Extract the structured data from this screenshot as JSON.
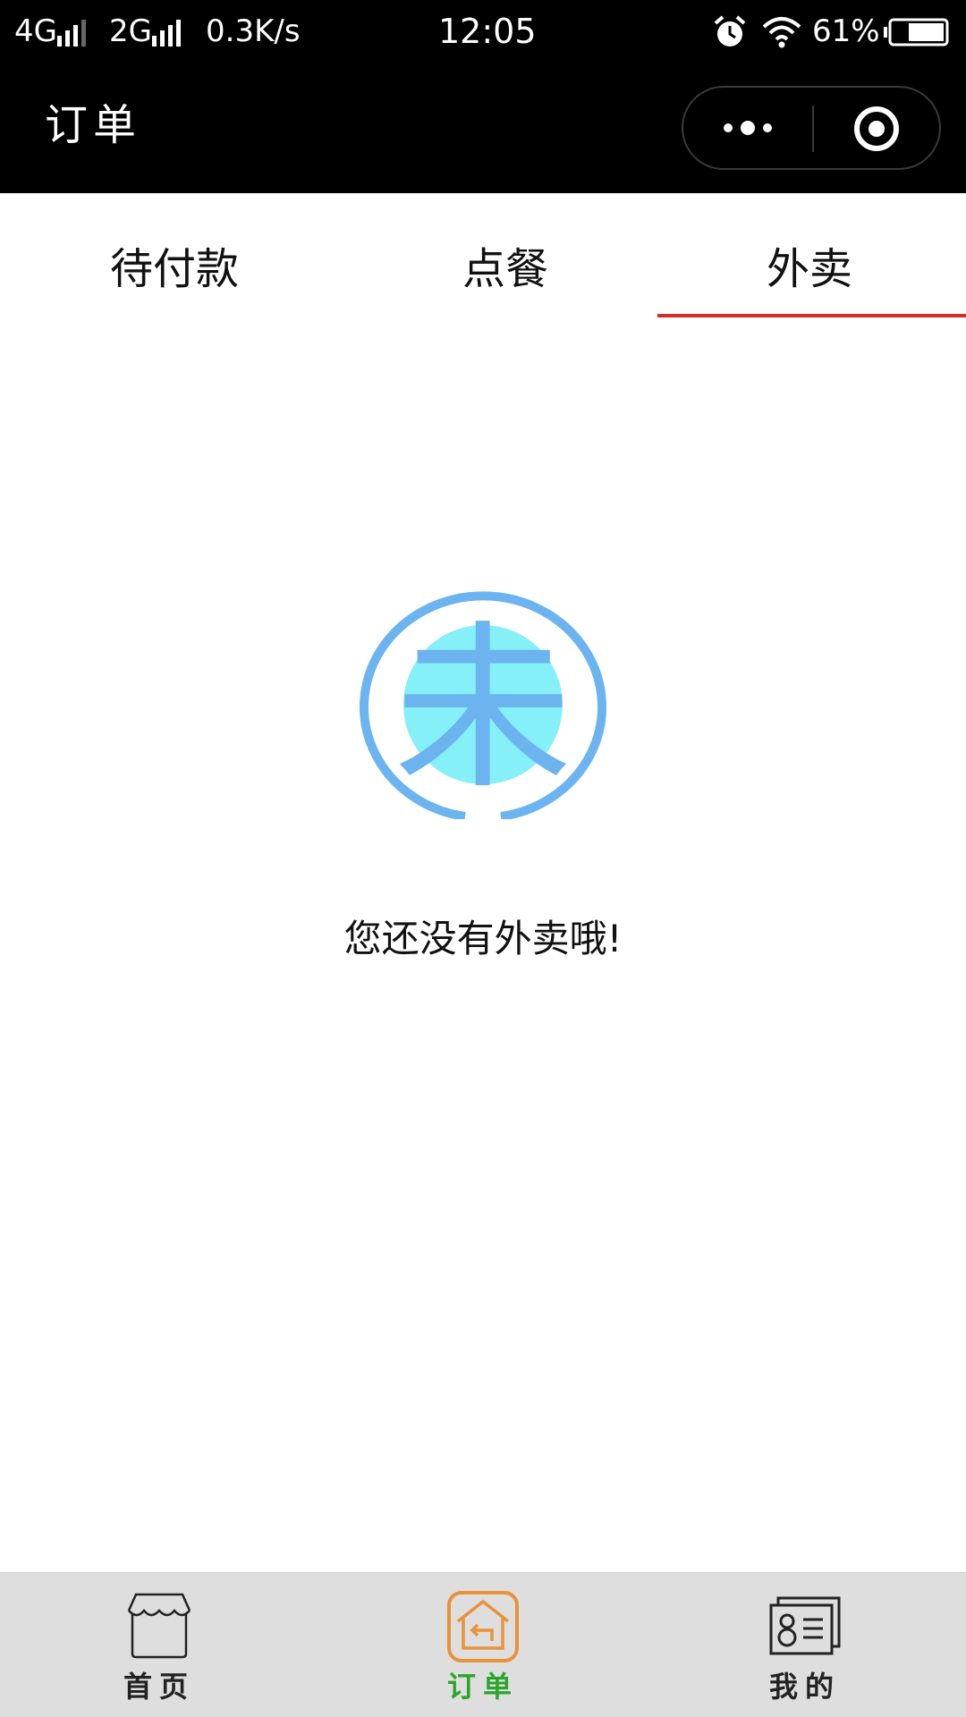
{
  "status_bar": {
    "network_1": "4G",
    "network_2": "2G",
    "speed": "0.3K/s",
    "time": "12:05",
    "battery": "61%"
  },
  "nav": {
    "title": "订单"
  },
  "tabs": [
    {
      "label": "待付款",
      "active": false
    },
    {
      "label": "点餐",
      "active": false
    },
    {
      "label": "外卖",
      "active": true
    }
  ],
  "empty_state": {
    "icon_char": "未",
    "message": "您还没有外卖哦!"
  },
  "bottom_nav": [
    {
      "label": "首页",
      "icon": "shop-icon",
      "active": false
    },
    {
      "label": "订单",
      "icon": "order-home-icon",
      "active": true
    },
    {
      "label": "我的",
      "icon": "profile-card-icon",
      "active": false
    }
  ],
  "colors": {
    "tab_underline": "#d62b2b",
    "bottom_active_label": "#2aa52a",
    "bottom_active_icon": "#e8923a",
    "empty_icon_ring": "#6cb4f0",
    "empty_icon_fill": "#86f0f8"
  }
}
